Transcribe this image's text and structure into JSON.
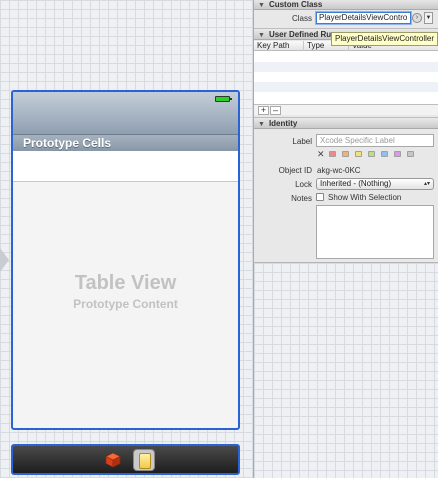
{
  "canvas": {
    "section_header": "Prototype Cells",
    "table_view_title": "Table View",
    "table_view_subtitle": "Prototype Content"
  },
  "inspector": {
    "custom_class": {
      "header": "Custom Class",
      "class_label": "Class",
      "class_value": "PlayerDetailsViewContro",
      "tooltip": "PlayerDetailsViewController"
    },
    "user_defined": {
      "header": "User Defined Ru",
      "columns": [
        "Key Path",
        "Type",
        "Value"
      ],
      "add_label": "+",
      "remove_label": "–"
    },
    "identity": {
      "header": "Identity",
      "label_label": "Label",
      "label_placeholder": "Xcode Specific Label",
      "label_colors": [
        "#f08a8a",
        "#f3b274",
        "#f1e27a",
        "#b9e27a",
        "#8fc0f0",
        "#d79ae6",
        "#c6c6c6"
      ],
      "object_id_label": "Object ID",
      "object_id_value": "akg-wc-0KC",
      "lock_label": "Lock",
      "lock_value": "Inherited - (Nothing)",
      "notes_label": "Notes",
      "show_with_selection": "Show With Selection"
    }
  },
  "colors": {
    "selection_blue": "#2a63d6",
    "navbar_top": "#c4ced9",
    "navbar_bottom": "#8f9fb1"
  }
}
